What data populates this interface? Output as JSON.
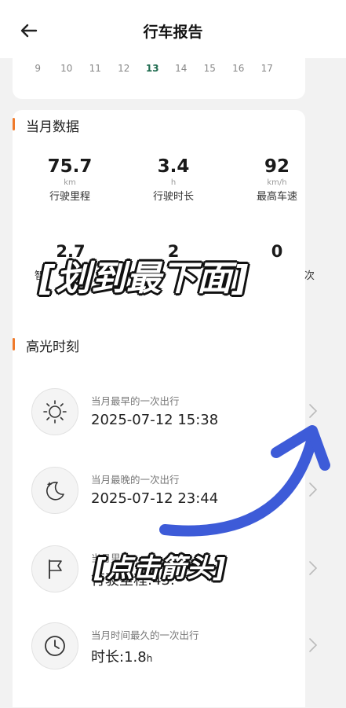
{
  "header": {
    "title": "行车报告"
  },
  "date_strip": {
    "days": [
      "9",
      "10",
      "11",
      "12",
      "13",
      "14",
      "15",
      "16",
      "17"
    ],
    "active_index": 4
  },
  "monthly": {
    "title": "当月数据",
    "stats": [
      {
        "value": "75.7",
        "unit": "km",
        "label": "行驶里程"
      },
      {
        "value": "3.4",
        "unit": "h",
        "label": "行驶时长"
      },
      {
        "value": "92",
        "unit": "km/h",
        "label": "最高车速"
      }
    ],
    "stats_row2": [
      {
        "value": "2.7",
        "label": "智"
      },
      {
        "value": "2",
        "label": "长"
      },
      {
        "value": "0",
        "label": "次"
      }
    ]
  },
  "highlights": {
    "title": "高光时刻",
    "items": [
      {
        "icon": "sun-icon",
        "label": "当月最早的一次出行",
        "value": "2025-07-12 15:38",
        "suffix": ""
      },
      {
        "icon": "moon-icon",
        "label": "当月最晚的一次出行",
        "value": "2025-07-12 23:44",
        "suffix": ""
      },
      {
        "icon": "flag-icon",
        "label": "当月里",
        "value": "行驶里程:43.",
        "suffix": ""
      },
      {
        "icon": "clock-icon",
        "label": "当月时间最久的一次出行",
        "value": "时长:1.8",
        "suffix": "h"
      }
    ]
  },
  "overlays": {
    "swipe_hint": "[划到最下面]",
    "tap_hint": "[点击箭头]"
  },
  "colors": {
    "accent": "#f07a2b",
    "active_date": "#1f6b4f",
    "arrow": "#3d5bd8"
  }
}
